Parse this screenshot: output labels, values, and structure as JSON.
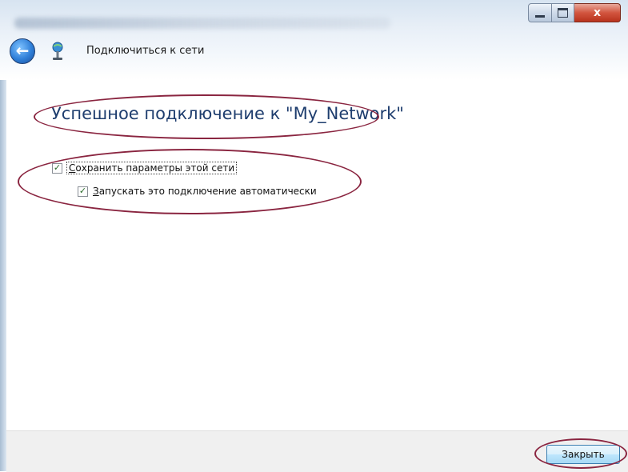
{
  "window": {
    "title": "Подключиться к сети",
    "close_glyph": "x",
    "controls": [
      "minimize-icon",
      "maximize-icon",
      "close-icon"
    ]
  },
  "nav": {
    "back_icon": "back-arrow-icon",
    "back_glyph": "←",
    "network_icon": "network-icon"
  },
  "content": {
    "heading": "Успешное подключение к \"My_Network\"",
    "checkboxes": [
      {
        "label_mnemonic": "С",
        "label_rest": "охранить параметры этой сети",
        "checked": true
      },
      {
        "label_mnemonic": "З",
        "label_rest": "апускать это подключение автоматически",
        "checked": true
      }
    ],
    "check_glyph": "✓"
  },
  "footer": {
    "close_button": "Закрыть"
  },
  "colors": {
    "heading": "#1e3d6e",
    "annotation": "#8a2540",
    "button_border": "#3c7fb1"
  }
}
